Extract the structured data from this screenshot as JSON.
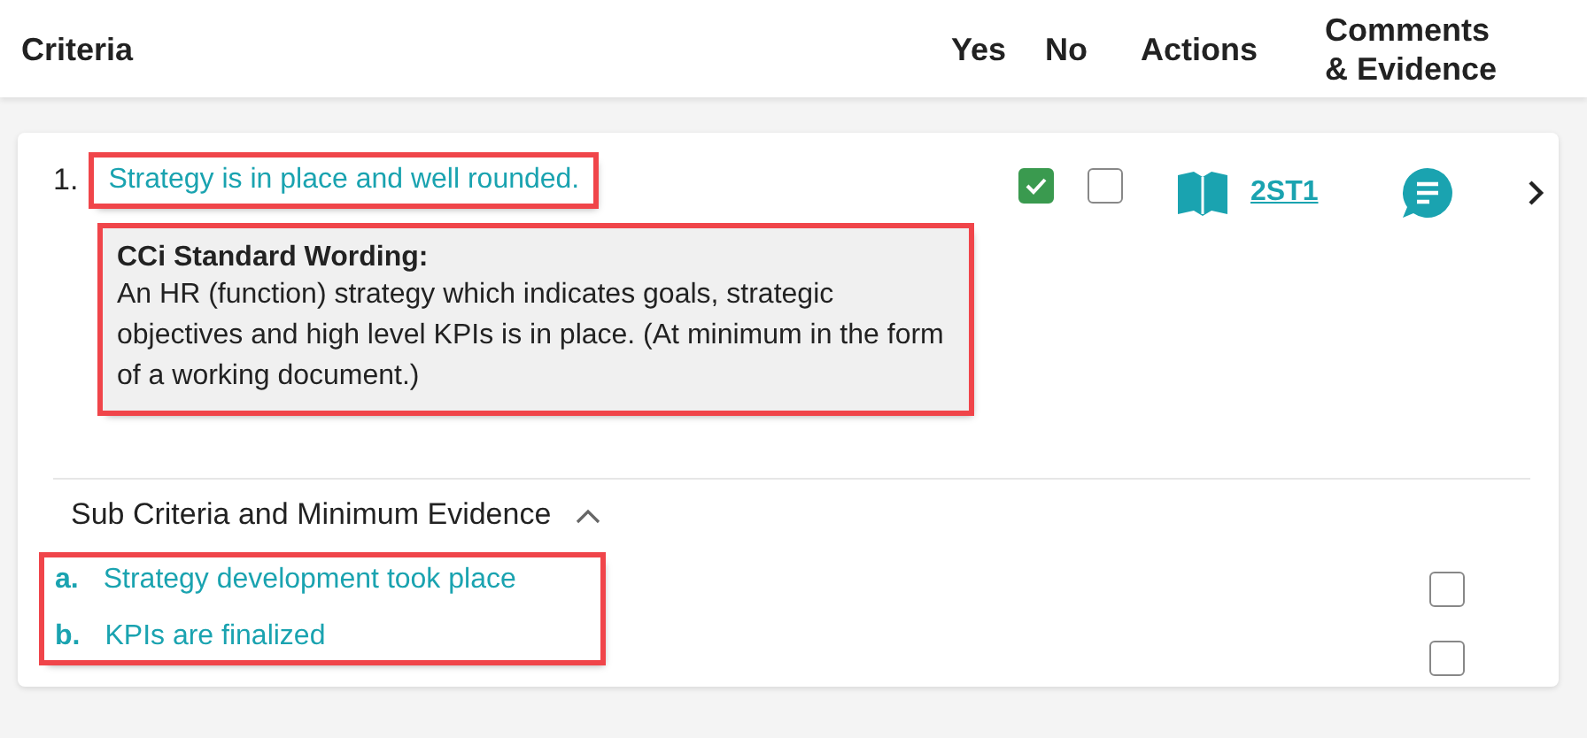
{
  "header": {
    "columns": [
      "Criteria",
      "Yes",
      "No",
      "Actions"
    ],
    "comments_column": [
      "Comments",
      "& Evidence"
    ]
  },
  "criteria": [
    {
      "number": "1.",
      "title": "Strategy is in place and well rounded.",
      "title_highlighted": true,
      "yes_checked": true,
      "no_checked": false,
      "action_code": "2ST1",
      "wording": {
        "heading": "CCi Standard Wording:",
        "text": "An HR (function) strategy which indicates goals, strategic objectives and high level KPIs is in place. (At minimum in the form of a working document.)",
        "highlighted": true
      },
      "sub_section": {
        "title": "Sub Criteria and Minimum Evidence",
        "expanded": true,
        "highlighted": true,
        "items": [
          {
            "letter": "a.",
            "text": "Strategy development took place",
            "checked": false
          },
          {
            "letter": "b.",
            "text": "KPIs are finalized",
            "checked": false
          }
        ]
      }
    }
  ]
}
